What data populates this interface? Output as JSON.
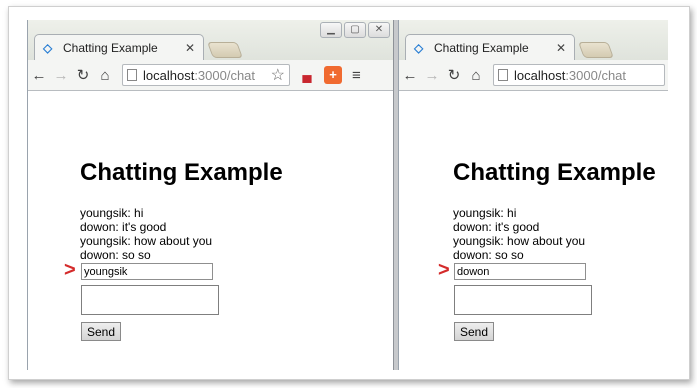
{
  "left_window": {
    "tab_title": "Chatting Example",
    "url_host": "localhost",
    "url_path": ":3000/chat",
    "heading": "Chatting Example",
    "messages": [
      "youngsik: hi",
      "dowon: it's good",
      "youngsik: how about you",
      "dowon: so so"
    ],
    "name_value": "youngsik",
    "send_label": "Send"
  },
  "right_window": {
    "tab_title": "Chatting Example",
    "url_host": "localhost",
    "url_path": ":3000/chat",
    "heading": "Chatting Example",
    "messages": [
      "youngsik: hi",
      "dowon: it's good",
      "youngsik: how about you",
      "dowon: so so"
    ],
    "name_value": "dowon",
    "send_label": "Send"
  },
  "icons": {
    "tab": "chrome-tab-icon",
    "close": "close-icon",
    "back": "back-arrow-icon",
    "forward": "forward-arrow-icon",
    "reload": "reload-icon",
    "home": "home-icon",
    "star": "bookmark-star-icon",
    "menu": "hamburger-menu-icon",
    "annotation": "red-arrow-annotation"
  },
  "colors": {
    "annotation": "#d42b2b",
    "tab_icon": "#2a7fd4",
    "extension_plus": "#f06a30"
  }
}
